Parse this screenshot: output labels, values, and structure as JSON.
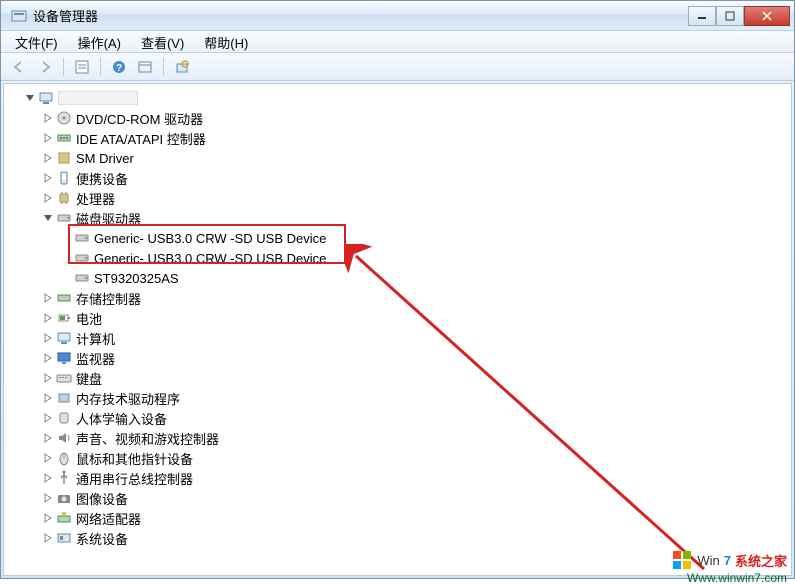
{
  "window": {
    "title": "设备管理器"
  },
  "menu": {
    "file": "文件(F)",
    "action": "操作(A)",
    "view": "查看(V)",
    "help": "帮助(H)"
  },
  "root": {
    "label": ""
  },
  "categories": [
    {
      "icon": "dvd",
      "label": "DVD/CD-ROM 驱动器",
      "expanded": false
    },
    {
      "icon": "ide",
      "label": "IDE ATA/ATAPI 控制器",
      "expanded": false
    },
    {
      "icon": "sm",
      "label": "SM Driver",
      "expanded": false
    },
    {
      "icon": "portable",
      "label": "便携设备",
      "expanded": false
    },
    {
      "icon": "cpu",
      "label": "处理器",
      "expanded": false
    },
    {
      "icon": "disk",
      "label": "磁盘驱动器",
      "expanded": true,
      "children": [
        {
          "icon": "drive",
          "label": "Generic- USB3.0 CRW   -SD USB Device",
          "highlighted": true
        },
        {
          "icon": "drive",
          "label": "Generic- USB3.0 CRW   -SD USB Device",
          "highlighted": true
        },
        {
          "icon": "drive",
          "label": "ST9320325AS"
        }
      ]
    },
    {
      "icon": "storage",
      "label": "存储控制器",
      "expanded": false
    },
    {
      "icon": "battery",
      "label": "电池",
      "expanded": false
    },
    {
      "icon": "computer",
      "label": "计算机",
      "expanded": false
    },
    {
      "icon": "monitor",
      "label": "监视器",
      "expanded": false
    },
    {
      "icon": "keyboard",
      "label": "键盘",
      "expanded": false
    },
    {
      "icon": "memtech",
      "label": "内存技术驱动程序",
      "expanded": false
    },
    {
      "icon": "hid",
      "label": "人体学输入设备",
      "expanded": false
    },
    {
      "icon": "sound",
      "label": "声音、视频和游戏控制器",
      "expanded": false
    },
    {
      "icon": "mouse",
      "label": "鼠标和其他指针设备",
      "expanded": false
    },
    {
      "icon": "usb",
      "label": "通用串行总线控制器",
      "expanded": false
    },
    {
      "icon": "imaging",
      "label": "图像设备",
      "expanded": false
    },
    {
      "icon": "network",
      "label": "网络适配器",
      "expanded": false
    },
    {
      "icon": "system",
      "label": "系统设备",
      "expanded": false
    }
  ],
  "watermark": {
    "brand_win": "Win",
    "brand_7": "7",
    "brand_text": "系统之家",
    "url": "Www.winwin7.com"
  }
}
